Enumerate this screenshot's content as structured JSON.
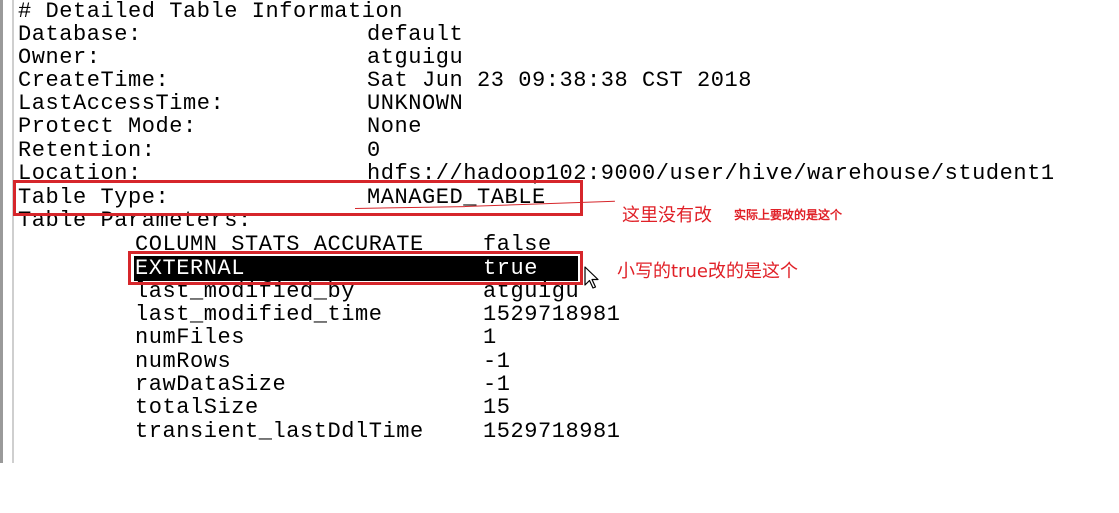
{
  "header": "# Detailed Table Information",
  "info_rows": [
    {
      "key": "Database:",
      "value": "default"
    },
    {
      "key": "Owner:",
      "value": "atguigu"
    },
    {
      "key": "CreateTime:",
      "value": "Sat Jun 23 09:38:38 CST 2018"
    },
    {
      "key": "LastAccessTime:",
      "value": "UNKNOWN"
    },
    {
      "key": "Protect Mode:",
      "value": "None"
    },
    {
      "key": "Retention:",
      "value": "0"
    },
    {
      "key": "Location:",
      "value": "hdfs://hadoop102:9000/user/hive/warehouse/student1"
    },
    {
      "key": "Table Type:",
      "value": "MANAGED_TABLE"
    }
  ],
  "params_header": "Table Parameters:",
  "params": [
    {
      "key": "COLUMN_STATS_ACCURATE",
      "value": "false"
    },
    {
      "key": "EXTERNAL",
      "value": "true"
    },
    {
      "key": "last_modified_by",
      "value": "atguigu"
    },
    {
      "key": "last_modified_time",
      "value": "1529718981"
    },
    {
      "key": "numFiles",
      "value": "1"
    },
    {
      "key": "numRows",
      "value": "-1"
    },
    {
      "key": "rawDataSize",
      "value": "-1"
    },
    {
      "key": "totalSize",
      "value": "15"
    },
    {
      "key": "transient_lastDdlTime",
      "value": "1529718981"
    }
  ],
  "highlighted_param_index": 1,
  "annotations": {
    "note1": "这里没有改",
    "note2": "实际上要改的是这个",
    "note3": "小写的true改的是这个",
    "color": "#e02027"
  },
  "icons": {
    "cursor": "mouse-pointer-icon"
  }
}
